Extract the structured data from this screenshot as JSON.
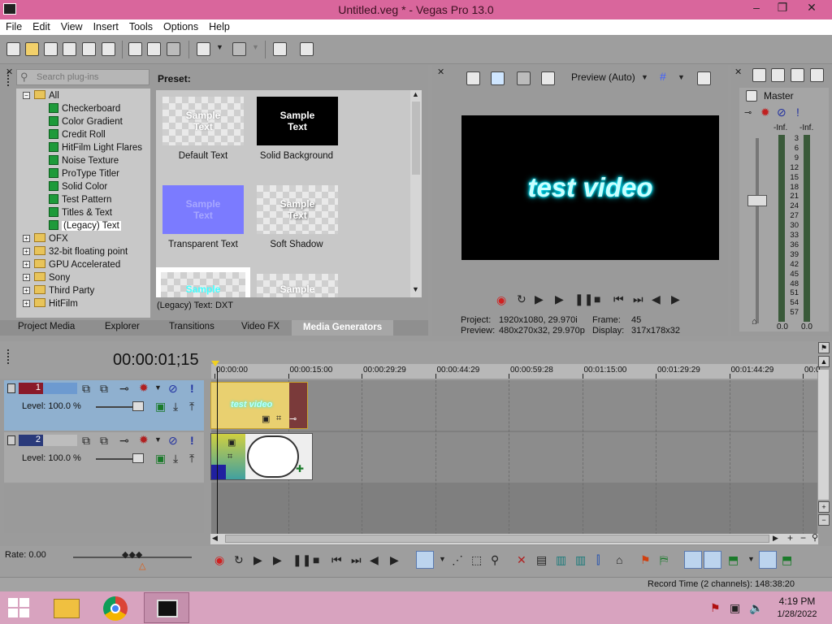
{
  "window": {
    "title": "Untitled.veg * - Vegas Pro 13.0",
    "minimize": "–",
    "restore": "❐",
    "close": "✕"
  },
  "menu": [
    "File",
    "Edit",
    "View",
    "Insert",
    "Tools",
    "Options",
    "Help"
  ],
  "plugins": {
    "search_placeholder": "Search plug-ins",
    "tree": [
      {
        "label": "All",
        "level": 0,
        "type": "folder",
        "expanded": true
      },
      {
        "label": "Checkerboard",
        "level": 1,
        "type": "gen"
      },
      {
        "label": "Color Gradient",
        "level": 1,
        "type": "gen"
      },
      {
        "label": "Credit Roll",
        "level": 1,
        "type": "gen"
      },
      {
        "label": "HitFilm Light Flares",
        "level": 1,
        "type": "gen"
      },
      {
        "label": "Noise Texture",
        "level": 1,
        "type": "gen"
      },
      {
        "label": "ProType Titler",
        "level": 1,
        "type": "gen"
      },
      {
        "label": "Solid Color",
        "level": 1,
        "type": "gen"
      },
      {
        "label": "Test Pattern",
        "level": 1,
        "type": "gen"
      },
      {
        "label": "Titles & Text",
        "level": 1,
        "type": "gen"
      },
      {
        "label": "(Legacy) Text",
        "level": 1,
        "type": "gen",
        "selected": true
      },
      {
        "label": "OFX",
        "level": 0,
        "type": "folder"
      },
      {
        "label": "32-bit floating point",
        "level": 0,
        "type": "folder"
      },
      {
        "label": "GPU Accelerated",
        "level": 0,
        "type": "folder"
      },
      {
        "label": "Sony",
        "level": 0,
        "type": "folder"
      },
      {
        "label": "Third Party",
        "level": 0,
        "type": "folder"
      },
      {
        "label": "HitFilm",
        "level": 0,
        "type": "folder"
      }
    ],
    "preset_label": "Preset:",
    "presets": [
      {
        "name": "Default Text",
        "thumb": "Sample\nText"
      },
      {
        "name": "Solid Background",
        "thumb": "Sample\nText"
      },
      {
        "name": "Transparent Text",
        "thumb": "Sample\nText"
      },
      {
        "name": "Soft Shadow",
        "thumb": "Sample\nText"
      }
    ],
    "bottom_thumb_1": "Sample",
    "bottom_thumb_2": "Sample",
    "status": "(Legacy) Text: DXT",
    "tabs": [
      "Project Media",
      "Explorer",
      "Transitions",
      "Video FX",
      "Media Generators"
    ]
  },
  "preview": {
    "quality": "Preview (Auto)",
    "frame_text": "test video",
    "project_label": "Project:",
    "project_value": "1920x1080, 29.970i",
    "preview_label": "Preview:",
    "preview_value": "480x270x32, 29.970p",
    "frame_label": "Frame:",
    "frame_value": "45",
    "display_label": "Display:",
    "display_value": "317x178x32"
  },
  "mixer": {
    "title": "Master",
    "left_inf": "-Inf.",
    "right_inf": "-Inf.",
    "scale": [
      "3",
      "6",
      "9",
      "12",
      "15",
      "18",
      "21",
      "24",
      "27",
      "30",
      "33",
      "36",
      "39",
      "42",
      "45",
      "48",
      "51",
      "54",
      "57"
    ],
    "left_value": "0.0",
    "right_value": "0.0"
  },
  "timeline": {
    "timecode": "00:00:01;15",
    "ruler": [
      "00:00:00",
      "00:00:15:00",
      "00:00:29:29",
      "00:00:44:29",
      "00:00:59:28",
      "00:01:15:00",
      "00:01:29:29",
      "00:01:44:29",
      "00:0"
    ],
    "track1": {
      "number": "1",
      "level": "Level: 100.0 %"
    },
    "track2": {
      "number": "2",
      "level": "Level: 100.0 %"
    },
    "clip1_text": "test video"
  },
  "transport": {
    "rate": "Rate: 0.00"
  },
  "status": {
    "record_time": "Record Time (2 channels): 148:38:20"
  },
  "taskbar": {
    "time": "4:19 PM",
    "date": "1/28/2022"
  }
}
